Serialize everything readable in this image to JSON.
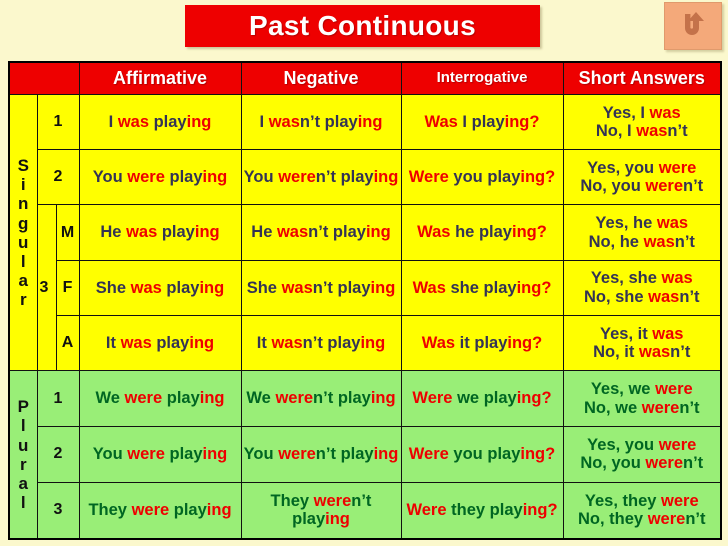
{
  "title": "Past Continuous",
  "back_button": {
    "icon": "undo-arrow-icon",
    "label": ""
  },
  "colors": {
    "accent_red": "#ee0000",
    "singular_bg": "#ffff00",
    "plural_bg": "#99ee77",
    "page_bg": "#fbf8cd",
    "singular_text": "#333355",
    "plural_text": "#006622",
    "back_button_bg": "#f4a97a"
  },
  "table": {
    "headers": [
      {
        "label": "",
        "key": "group"
      },
      {
        "label": "",
        "key": "person"
      },
      {
        "label": "Affirmative",
        "key": "affirmative"
      },
      {
        "label": "Negative",
        "key": "negative"
      },
      {
        "label": "Interrogative",
        "key": "interrogative"
      },
      {
        "label": "Short Answers",
        "key": "short_answers"
      }
    ],
    "groups": [
      {
        "name": "Singular",
        "letters": [
          "S",
          "i",
          "n",
          "g",
          "u",
          "l",
          "a",
          "r"
        ],
        "rows": [
          {
            "person": "1",
            "person_marker": "",
            "gender": "",
            "affirmative": {
              "subj": "I",
              "aux": "was",
              "stem": "play",
              "ing": "ing"
            },
            "negative": {
              "subj": "I",
              "aux": "was",
              "neg": "n’t",
              "stem": "play",
              "ing": "ing"
            },
            "interrogative": {
              "aux": "Was",
              "subj": "I",
              "stem": "play",
              "ing": "ing",
              "mark": "?"
            },
            "short_yes": {
              "lead": "Yes, I",
              "aux": "was"
            },
            "short_no": {
              "lead": "No, I",
              "aux": "was",
              "neg": "n’t"
            }
          },
          {
            "person": "2",
            "person_marker": "",
            "gender": "",
            "affirmative": {
              "subj": "You",
              "aux": "were",
              "stem": "play",
              "ing": "ing"
            },
            "negative": {
              "subj": "You",
              "aux": "were",
              "neg": "n’t",
              "stem": "play",
              "ing": "ing"
            },
            "interrogative": {
              "aux": "Were",
              "subj": "you",
              "stem": "play",
              "ing": "ing",
              "mark": "?"
            },
            "short_yes": {
              "lead": "Yes, you",
              "aux": "were"
            },
            "short_no": {
              "lead": "No, you",
              "aux": "were",
              "neg": "n’t"
            }
          },
          {
            "person": "3",
            "person_marker": "3",
            "gender": "M",
            "affirmative": {
              "subj": "He",
              "aux": "was",
              "stem": "play",
              "ing": "ing"
            },
            "negative": {
              "subj": "He",
              "aux": "was",
              "neg": "n’t",
              "stem": "play",
              "ing": "ing"
            },
            "interrogative": {
              "aux": "Was",
              "subj": "he",
              "stem": "play",
              "ing": "ing",
              "mark": "?"
            },
            "short_yes": {
              "lead": "Yes, he",
              "aux": "was"
            },
            "short_no": {
              "lead": "No, he",
              "aux": "was",
              "neg": "n’t"
            }
          },
          {
            "person": "3",
            "person_marker": "",
            "gender": "F",
            "affirmative": {
              "subj": "She",
              "aux": "was",
              "stem": "play",
              "ing": "ing"
            },
            "negative": {
              "subj": "She",
              "aux": "was",
              "neg": "n’t",
              "stem": "play",
              "ing": "ing"
            },
            "interrogative": {
              "aux": "Was",
              "subj": "she",
              "stem": "play",
              "ing": "ing",
              "mark": "?"
            },
            "short_yes": {
              "lead": "Yes, she",
              "aux": "was"
            },
            "short_no": {
              "lead": "No, she",
              "aux": "was",
              "neg": "n’t"
            }
          },
          {
            "person": "3",
            "person_marker": "",
            "gender": "A",
            "affirmative": {
              "subj": "It",
              "aux": "was",
              "stem": "play",
              "ing": "ing"
            },
            "negative": {
              "subj": "It",
              "aux": "was",
              "neg": "n’t",
              "stem": "play",
              "ing": "ing"
            },
            "interrogative": {
              "aux": "Was",
              "subj": "it",
              "stem": "play",
              "ing": "ing",
              "mark": "?"
            },
            "short_yes": {
              "lead": "Yes, it",
              "aux": "was"
            },
            "short_no": {
              "lead": "No, it",
              "aux": "was",
              "neg": "n’t"
            }
          }
        ]
      },
      {
        "name": "Plural",
        "letters": [
          "P",
          "l",
          "u",
          "r",
          "a",
          "l"
        ],
        "rows": [
          {
            "person": "1",
            "person_marker": "",
            "gender": "",
            "affirmative": {
              "subj": "We",
              "aux": "were",
              "stem": "play",
              "ing": "ing"
            },
            "negative": {
              "subj": "We",
              "aux": "were",
              "neg": "n’t",
              "stem": "play",
              "ing": "ing"
            },
            "interrogative": {
              "aux": "Were",
              "subj": "we",
              "stem": "play",
              "ing": "ing",
              "mark": "?"
            },
            "short_yes": {
              "lead": "Yes, we",
              "aux": "were"
            },
            "short_no": {
              "lead": "No, we",
              "aux": "were",
              "neg": "n’t"
            }
          },
          {
            "person": "2",
            "person_marker": "",
            "gender": "",
            "affirmative": {
              "subj": "You",
              "aux": "were",
              "stem": "play",
              "ing": "ing"
            },
            "negative": {
              "subj": "You",
              "aux": "were",
              "neg": "n’t",
              "stem": "play",
              "ing": "ing"
            },
            "interrogative": {
              "aux": "Were",
              "subj": "you",
              "stem": "play",
              "ing": "ing",
              "mark": "?"
            },
            "short_yes": {
              "lead": "Yes, you",
              "aux": "were"
            },
            "short_no": {
              "lead": "No, you",
              "aux": "were",
              "neg": "n’t"
            }
          },
          {
            "person": "3",
            "person_marker": "",
            "gender": "",
            "affirmative": {
              "subj": "They",
              "aux": "were",
              "stem": "play",
              "ing": "ing"
            },
            "negative": {
              "subj": "They",
              "aux": "were",
              "neg": "n’t",
              "stem": "play",
              "ing": "ing"
            },
            "interrogative": {
              "aux": "Were",
              "subj": "they",
              "stem": "play",
              "ing": "ing",
              "mark": "?"
            },
            "short_yes": {
              "lead": "Yes, they",
              "aux": "were"
            },
            "short_no": {
              "lead": "No, they",
              "aux": "were",
              "neg": "n’t"
            }
          }
        ]
      }
    ]
  }
}
